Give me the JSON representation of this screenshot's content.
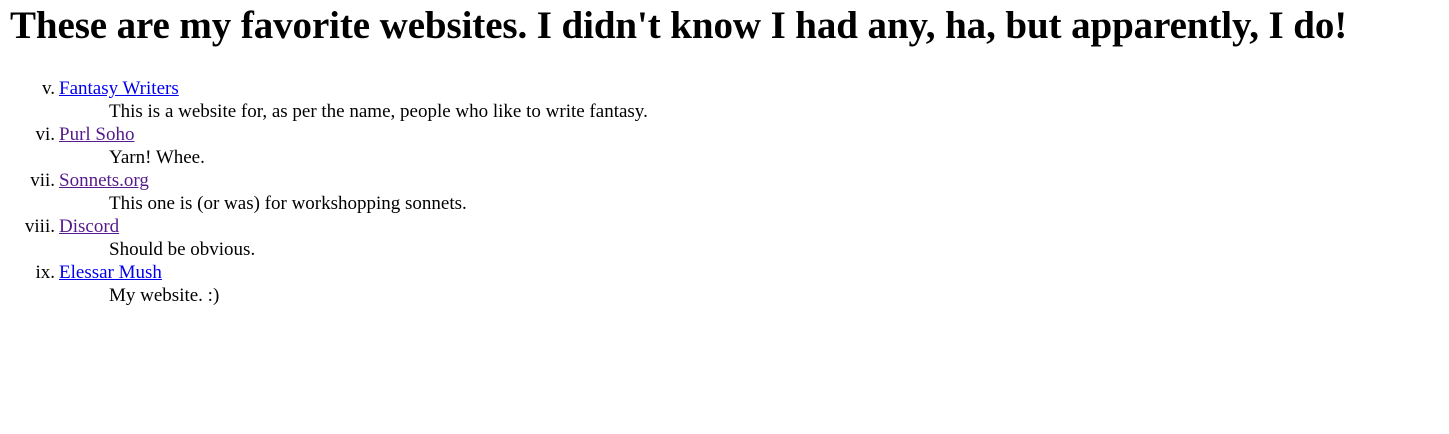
{
  "page": {
    "heading": "These are my favorite websites. I didn't know I had any, ha, but apparently, I do!"
  },
  "sites": [
    {
      "marker": "v.",
      "name": "Fantasy Writers",
      "description": "This is a website for, as per the name, people who like to write fantasy.",
      "visited": false
    },
    {
      "marker": "vi.",
      "name": "Purl Soho",
      "description": "Yarn! Whee.",
      "visited": true
    },
    {
      "marker": "vii.",
      "name": "Sonnets.org",
      "description": "This one is (or was) for workshopping sonnets.",
      "visited": true
    },
    {
      "marker": "viii.",
      "name": "Discord",
      "description": "Should be obvious.",
      "visited": true
    },
    {
      "marker": "ix.",
      "name": "Elessar Mush",
      "description": "My website. :)",
      "visited": false
    }
  ],
  "colors": {
    "link": "#0000ee",
    "visited_link": "#551a8b",
    "text": "#000000",
    "background": "#ffffff"
  }
}
